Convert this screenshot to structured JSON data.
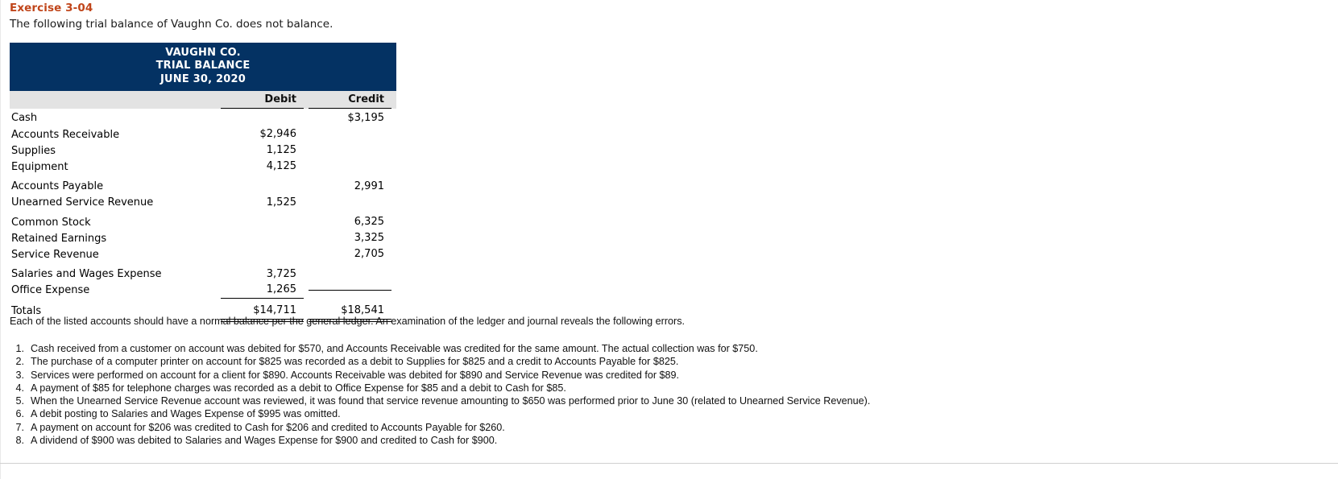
{
  "exercise": {
    "title": "Exercise 3-04",
    "intro": "The following trial balance of Vaughn Co. does not balance."
  },
  "colors": {
    "title_accent": "#c0451a",
    "table_header_bg": "#043263",
    "column_header_bg": "#e3e3e3"
  },
  "trial_balance": {
    "header_lines": [
      "VAUGHN CO.",
      "TRIAL BALANCE",
      "JUNE 30, 2020"
    ],
    "columns": {
      "account": "",
      "debit": "Debit",
      "credit": "Credit"
    },
    "rows": [
      {
        "account": "Cash",
        "debit": "",
        "credit": "$3,195"
      },
      {
        "account": "Accounts Receivable",
        "debit": "$2,946",
        "credit": ""
      },
      {
        "account": "Supplies",
        "debit": "1,125",
        "credit": ""
      },
      {
        "account": "Equipment",
        "debit": "4,125",
        "credit": ""
      },
      {
        "account": "Accounts Payable",
        "debit": "",
        "credit": "2,991"
      },
      {
        "account": "Unearned Service Revenue",
        "debit": "1,525",
        "credit": ""
      },
      {
        "account": "Common Stock",
        "debit": "",
        "credit": "6,325"
      },
      {
        "account": "Retained Earnings",
        "debit": "",
        "credit": "3,325"
      },
      {
        "account": "Service Revenue",
        "debit": "",
        "credit": "2,705"
      },
      {
        "account": "Salaries and Wages Expense",
        "debit": "3,725",
        "credit": ""
      },
      {
        "account": "Office Expense",
        "debit": "1,265",
        "credit": ""
      }
    ],
    "totals": {
      "account": "Totals",
      "debit": "$14,711",
      "credit": "$18,541"
    }
  },
  "narrative": "Each of the listed accounts should have a normal balance per the general ledger. An examination of the ledger and journal reveals the following errors.",
  "errors": [
    {
      "num": "1.",
      "text": "Cash received from a customer on account was debited for $570, and Accounts Receivable was credited for the same amount. The actual collection was for $750."
    },
    {
      "num": "2.",
      "text": "The purchase of a computer printer on account for $825 was recorded as a debit to Supplies for $825 and a credit to Accounts Payable for $825."
    },
    {
      "num": "3.",
      "text": "Services were performed on account for a client for $890. Accounts Receivable was debited for $890 and Service Revenue was credited for $89."
    },
    {
      "num": "4.",
      "text": "A payment of $85 for telephone charges was recorded as a debit to Office Expense for $85 and a debit to Cash for $85."
    },
    {
      "num": "5.",
      "text": "When the Unearned Service Revenue account was reviewed, it was found that service revenue amounting to $650 was performed prior to June 30 (related to Unearned Service Revenue)."
    },
    {
      "num": "6.",
      "text": "A debit posting to Salaries and Wages Expense of $995 was omitted."
    },
    {
      "num": "7.",
      "text": "A payment on account for $206 was credited to Cash for $206 and credited to Accounts Payable for $260."
    },
    {
      "num": "8.",
      "text": "A dividend of $900 was debited to Salaries and Wages Expense for $900 and credited to Cash for $900."
    }
  ]
}
